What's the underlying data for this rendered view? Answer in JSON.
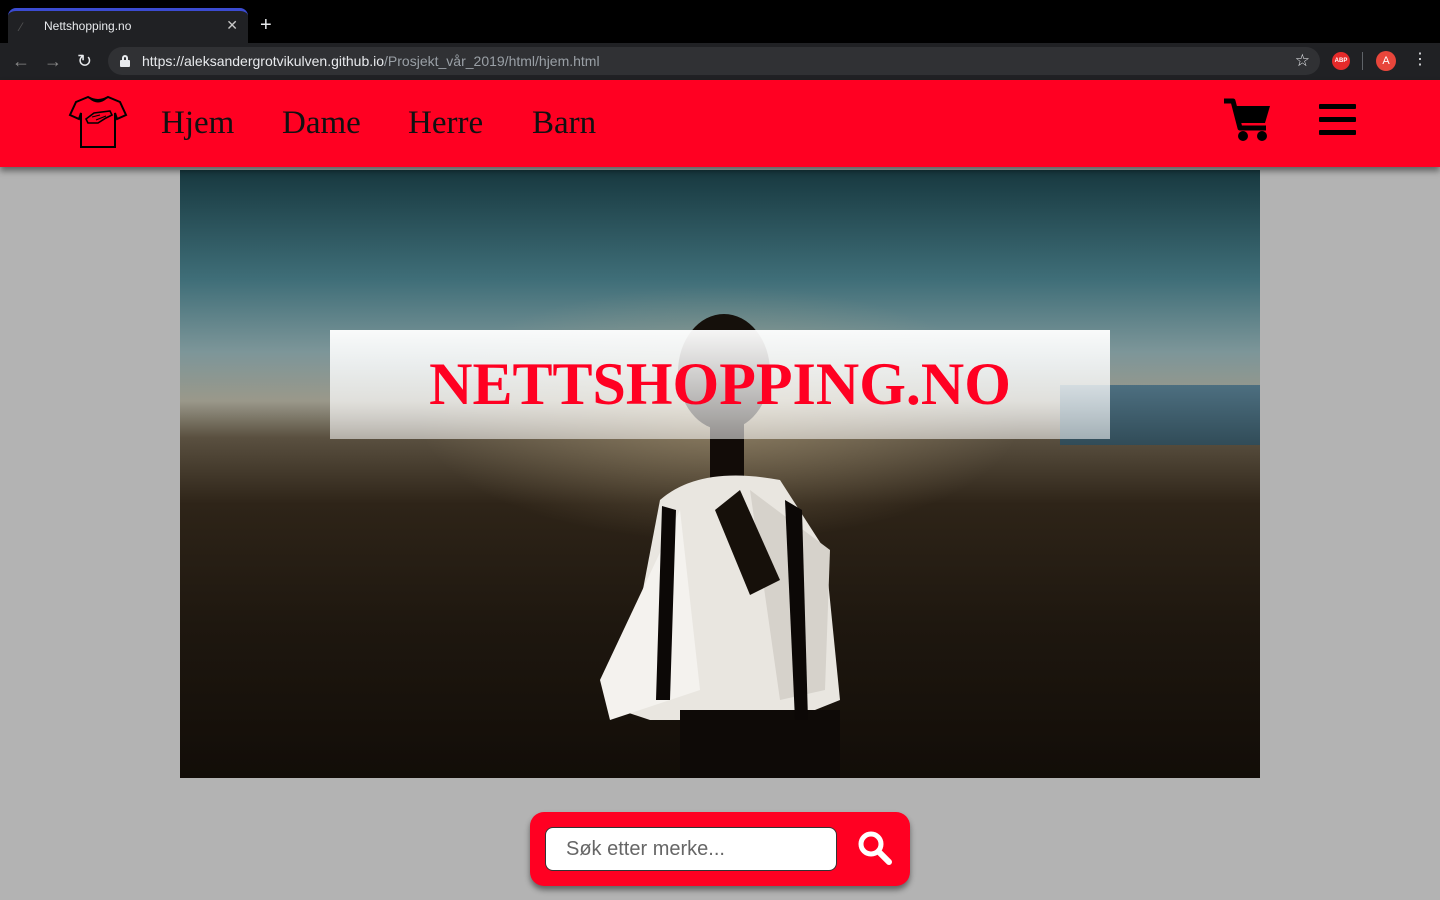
{
  "browser": {
    "tab_title": "Nettshopping.no",
    "tab_close": "✕",
    "new_tab": "+",
    "url_host": "https://aleksandergrotvikulven.github.io",
    "url_path": "/Prosjekt_vår_2019/html/hjem.html",
    "abp_label": "ABP",
    "avatar_letter": "A"
  },
  "nav": {
    "links": [
      "Hjem",
      "Dame",
      "Herre",
      "Barn"
    ]
  },
  "hero": {
    "title": "NETTSHOPPING.NO"
  },
  "search": {
    "placeholder": "Søk etter merke..."
  },
  "colors": {
    "brand_red": "#ff0022",
    "page_background": "#b3b3b3"
  },
  "icons": [
    "tshirt-logo-icon",
    "cart-icon",
    "hamburger-menu-icon",
    "search-icon"
  ]
}
